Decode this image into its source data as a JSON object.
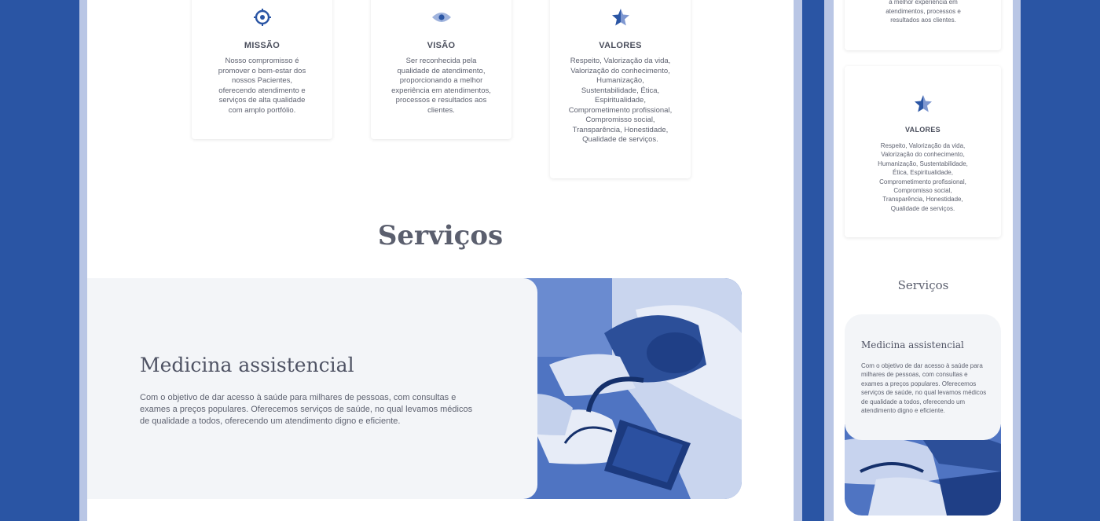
{
  "desktop": {
    "cards": [
      {
        "icon": "target-icon",
        "title": "MISSÃO",
        "text": "Nosso compromisso é promover o bem-estar dos nossos Pacientes, oferecendo atendimento e serviços de alta qualidade com amplo portfólio."
      },
      {
        "icon": "eye-icon",
        "title": "VISÃO",
        "text": "Ser reconhecida pela qualidade de atendimento, proporcionando a melhor experiência em atendimentos, processos e resultados aos clientes."
      },
      {
        "icon": "star-icon",
        "title": "VALORES",
        "text": "Respeito, Valorização da vida, Valorização do conhecimento, Humanização, Sustentabilidade, Ética, Espiritualidade, Comprometimento profissional, Compromisso social, Transparência, Honestidade, Qualidade de serviços."
      }
    ],
    "services_heading": "Serviços",
    "service": {
      "title": "Medicina assistencial",
      "text": "Com o objetivo de dar acesso à saúde para milhares de pessoas, com consultas e exames a preços populares. Oferecemos serviços de saúde, no qual levamos médicos de qualidade a todos, oferecendo um atendimento digno e eficiente.",
      "image": "blood-pressure-photo"
    }
  },
  "mobile": {
    "partial_card_text": "a melhor experiência em atendimentos, processos e resultados aos clientes.",
    "values_card": {
      "icon": "star-icon",
      "title": "VALORES",
      "text": "Respeito, Valorização da vida, Valorização do conhecimento, Humanização, Sustentabilidade, Ética, Espiritualidade, Comprometimento profissional, Compromisso social, Transparência, Honestidade, Qualidade de serviços."
    },
    "services_heading": "Serviços",
    "service": {
      "title": "Medicina assistencial",
      "text": "Com o objetivo de dar acesso à saúde para milhares de pessoas, com consultas e exames a preços populares. Oferecemos serviços de saúde, no qual levamos médicos de qualidade a todos, oferecendo um atendimento digno e eficiente.",
      "image": "blood-pressure-photo"
    }
  },
  "colors": {
    "background": "#2a55a4",
    "frame": "#b9c6e5",
    "accent": "#2a55a4",
    "text": "#5a5f6e"
  }
}
